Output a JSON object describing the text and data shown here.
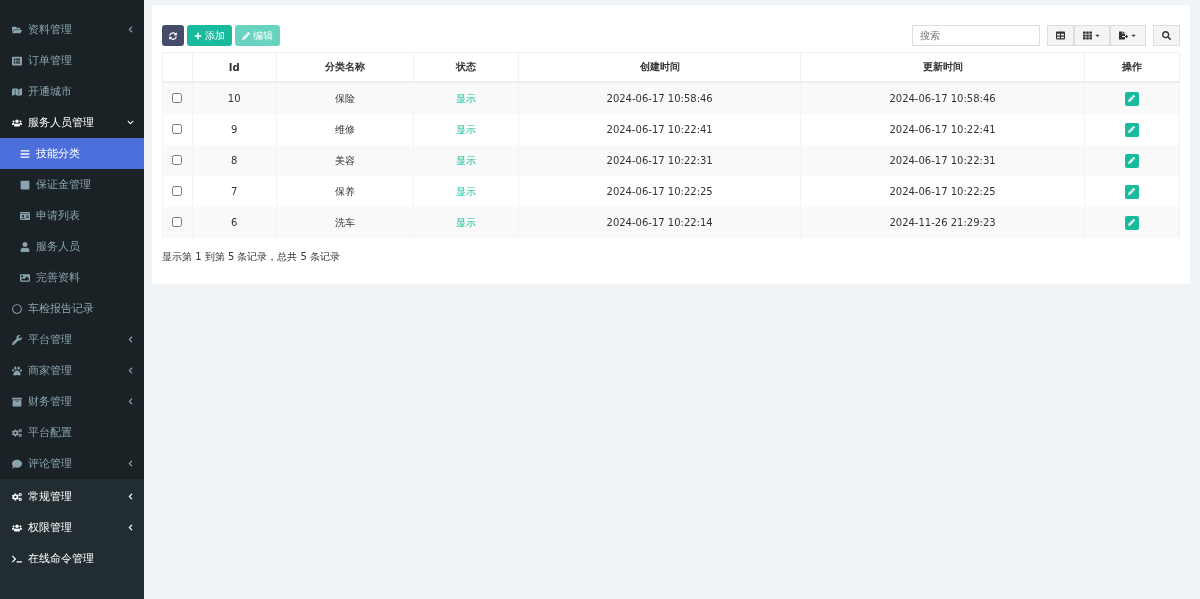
{
  "sidebar": {
    "items": [
      {
        "label": "资料管理",
        "expanded": false
      },
      {
        "label": "订单管理"
      },
      {
        "label": "开通城市"
      },
      {
        "label": "服务人员管理",
        "expanded": true,
        "children": [
          {
            "label": "技能分类",
            "selected": true
          },
          {
            "label": "保证金管理",
            "selected": false
          },
          {
            "label": "申请列表",
            "selected": false
          },
          {
            "label": "服务人员",
            "selected": false
          },
          {
            "label": "完善资料",
            "selected": false
          }
        ]
      },
      {
        "label": "车检报告记录"
      },
      {
        "label": "平台管理",
        "expanded": false
      },
      {
        "label": "商家管理",
        "expanded": false
      },
      {
        "label": "财务管理",
        "expanded": false
      },
      {
        "label": "平台配置"
      },
      {
        "label": "评论管理",
        "expanded": false
      }
    ],
    "system_items": [
      {
        "label": "常规管理",
        "expanded": false
      },
      {
        "label": "权限管理",
        "expanded": false
      },
      {
        "label": "在线命令管理"
      }
    ]
  },
  "toolbar": {
    "buttons": [
      {
        "kind": "refresh",
        "disabled": false
      },
      {
        "kind": "add",
        "label": "添加",
        "disabled": false
      },
      {
        "kind": "edit",
        "label": "编辑",
        "disabled": true
      }
    ],
    "search": {
      "placeholder": "搜索"
    }
  },
  "table": {
    "columns": [
      "",
      "Id",
      "分类名称",
      "状态",
      "创建时间",
      "更新时间",
      "操作"
    ],
    "rows": [
      {
        "checked": false,
        "id": "10",
        "name": "保险",
        "status": "显示",
        "created": "2024-06-17 10:58:46",
        "updated": "2024-06-17 10:58:46"
      },
      {
        "checked": false,
        "id": "9",
        "name": "维修",
        "status": "显示",
        "created": "2024-06-17 10:22:41",
        "updated": "2024-06-17 10:22:41"
      },
      {
        "checked": false,
        "id": "8",
        "name": "美容",
        "status": "显示",
        "created": "2024-06-17 10:22:31",
        "updated": "2024-06-17 10:22:31"
      },
      {
        "checked": false,
        "id": "7",
        "name": "保养",
        "status": "显示",
        "created": "2024-06-17 10:22:25",
        "updated": "2024-06-17 10:22:25"
      },
      {
        "checked": false,
        "id": "6",
        "name": "洗车",
        "status": "显示",
        "created": "2024-06-17 10:22:14",
        "updated": "2024-11-26 21:29:23"
      }
    ]
  },
  "pagination": {
    "summary": "显示第 1 到第 5 条记录，总共 5 条记录"
  }
}
